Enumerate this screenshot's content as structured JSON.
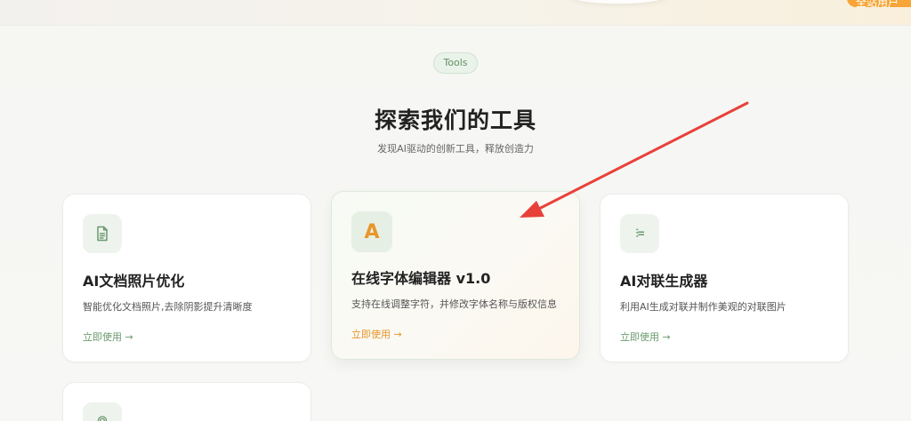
{
  "header": {
    "top_button_label": "全站用户"
  },
  "section": {
    "badge": "Tools",
    "title": "探索我们的工具",
    "subtitle": "发现AI驱动的创新工具，释放创造力"
  },
  "cards": [
    {
      "title": "AI文档照片优化",
      "description": "智能优化文档照片,去除阴影提升清晰度",
      "link": "立即使用 →",
      "icon": "document-icon"
    },
    {
      "title": "在线字体编辑器 v1.0",
      "description": "支持在线调整字符，并修改字体名称与版权信息",
      "link": "立即使用 →",
      "icon": "letter-a-icon",
      "icon_glyph": "A"
    },
    {
      "title": "AI对联生成器",
      "description": "利用AI生成对联并制作美观的对联图片",
      "link": "立即使用 →",
      "icon": "couplet-icon",
      "icon_glyph": "⫶="
    },
    {
      "icon": "location-pin-icon"
    }
  ],
  "colors": {
    "accent_green": "#6a9a6e",
    "accent_orange": "#e8962a",
    "annotation_arrow": "#e8413a"
  }
}
